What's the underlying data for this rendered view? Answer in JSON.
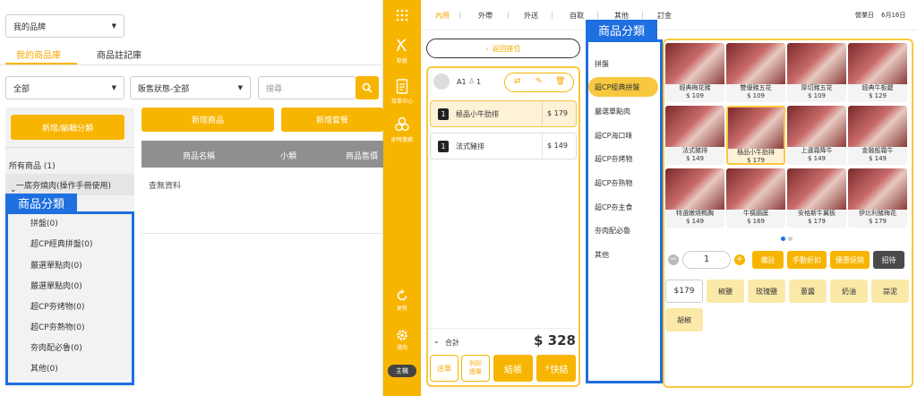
{
  "left": {
    "brand_select": "我的品牌",
    "tabs": [
      "我的商品庫",
      "商品註記庫"
    ],
    "filter_all": "全部",
    "filter_status": "販售狀態-全部",
    "search_placeholder": "搜尋",
    "add_category_btn": "新增/編輯分類",
    "add_product_btn": "新增商品",
    "add_set_btn": "新增套餐",
    "table_headers": [
      "商品名稱",
      "小類",
      "商品售價"
    ],
    "no_data": "查無資料",
    "all_products": "所有商品 (1)",
    "parent_category": "一底夯燒肉(操作手冊使用)",
    "categories": [
      "拼盤(0)",
      "超CP經典拼盤(0)",
      "嚴選單點肉(0)",
      "嚴選單點肉(0)",
      "超CP夯烤物(0)",
      "超CP夯熟物(0)",
      "夯肉配必魯(0)",
      "其他(0)"
    ],
    "category_tag": "商品分類"
  },
  "pos": {
    "sidebar": [
      "點餐",
      "接單中心",
      "即時業績",
      "更新",
      "選用",
      "主機"
    ],
    "topnav": [
      "內用",
      "外帶",
      "外送",
      "自取",
      "其他",
      "訂金"
    ],
    "business_day": "營業日",
    "date": "6月16日",
    "back_btn": "返回座位",
    "table_label": "A1",
    "guest_count": "1",
    "order_items": [
      {
        "qty": "1",
        "name": "極品小牛肋排",
        "price": "$ 179"
      },
      {
        "qty": "1",
        "name": "法式豬排",
        "price": "$ 149"
      }
    ],
    "total_label": "合計",
    "total": "$ 328",
    "bottom_btns": [
      "送單",
      "列印\n總單",
      "結帳",
      "快結"
    ],
    "category_tag": "商品分類",
    "categories": [
      "拼盤",
      "超CP經典拼盤",
      "嚴選單點肉",
      "超CP海口味",
      "超CP夯烤物",
      "超CP夯熟物",
      "超CP夯主食",
      "夯肉配必魯",
      "其他"
    ],
    "products": [
      {
        "name": "經典梅花豬",
        "price": "$ 109"
      },
      {
        "name": "雙優豬五花",
        "price": "$ 109"
      },
      {
        "name": "厚切豬五花",
        "price": "$ 109"
      },
      {
        "name": "經典牛板腱",
        "price": "$ 129"
      },
      {
        "name": "法式豬排",
        "price": "$ 149"
      },
      {
        "name": "極品小牛肋排",
        "price": "$ 179"
      },
      {
        "name": "上選霜降牛",
        "price": "$ 149"
      },
      {
        "name": "金融般霜牛",
        "price": "$ 149"
      },
      {
        "name": "特選嫩燒鴨胸",
        "price": "$ 149"
      },
      {
        "name": "牛橫膈膜",
        "price": "$ 169"
      },
      {
        "name": "安格斯牛翼板",
        "price": "$ 179"
      },
      {
        "name": "伊比利豬梅花",
        "price": "$ 179"
      }
    ],
    "qty_value": "1",
    "action_btns": [
      "備註",
      "手動折扣",
      "優惠促銷",
      "招待"
    ],
    "price_chip": "$179",
    "option_chips": [
      "椒鹽",
      "玫瑰鹽",
      "蔥醬",
      "奶油",
      "蒜泥",
      "胡椒"
    ]
  }
}
